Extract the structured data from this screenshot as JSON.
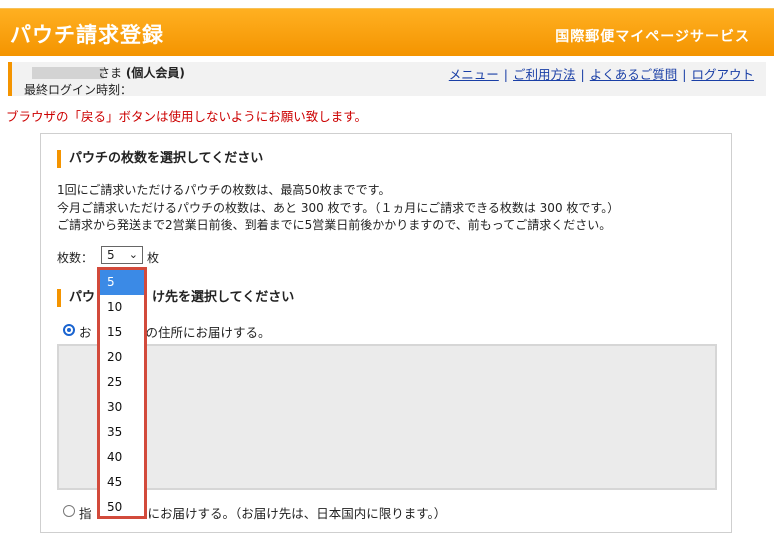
{
  "header": {
    "title": "パウチ請求登録",
    "service": "国際郵便マイページサービス"
  },
  "user": {
    "sama": "さま",
    "kind": "(個人会員)",
    "last_login": "最終ログイン時刻："
  },
  "nav": {
    "menu": "メニュー",
    "usage": "ご利用方法",
    "faq": "よくあるご質問",
    "logout": "ログアウト",
    "separator": "|"
  },
  "warning": "ブラウザの「戻る」ボタンは使用しないようにお願い致します。",
  "section1": {
    "title": "パウチの枚数を選択してください",
    "line1": "1回にご請求いただけるパウチの枚数は、最高50枚までです。",
    "line2": "今月ご請求いただけるパウチの枚数は、あと 300 枚です。（１ヵ月にご請求できる枚数は 300 枚です。）",
    "line3": "ご請求から発送まで2営業日前後、到着までに5営業日前後かかりますので、前もってご請求ください。",
    "qty_label": "枚数：",
    "qty_selected": "5",
    "qty_unit": "枚"
  },
  "section2": {
    "title_start": "パウ",
    "title_end": "け先を選択してください",
    "option1_start": "お",
    "option1_end": "の住所にお届けする。",
    "option2_start": "指",
    "option2_end": "にお届けする。（お届け先は、日本国内に限ります。）"
  },
  "dropdown": {
    "options": [
      "5",
      "10",
      "15",
      "20",
      "25",
      "30",
      "35",
      "40",
      "45",
      "50"
    ],
    "selected": "5"
  },
  "colors": {
    "header_orange": "#f49400",
    "link_blue": "#1a3fa6",
    "warning_red": "#cc0000",
    "highlight_red": "#d24a3b",
    "selected_blue": "#3b8ae6"
  }
}
